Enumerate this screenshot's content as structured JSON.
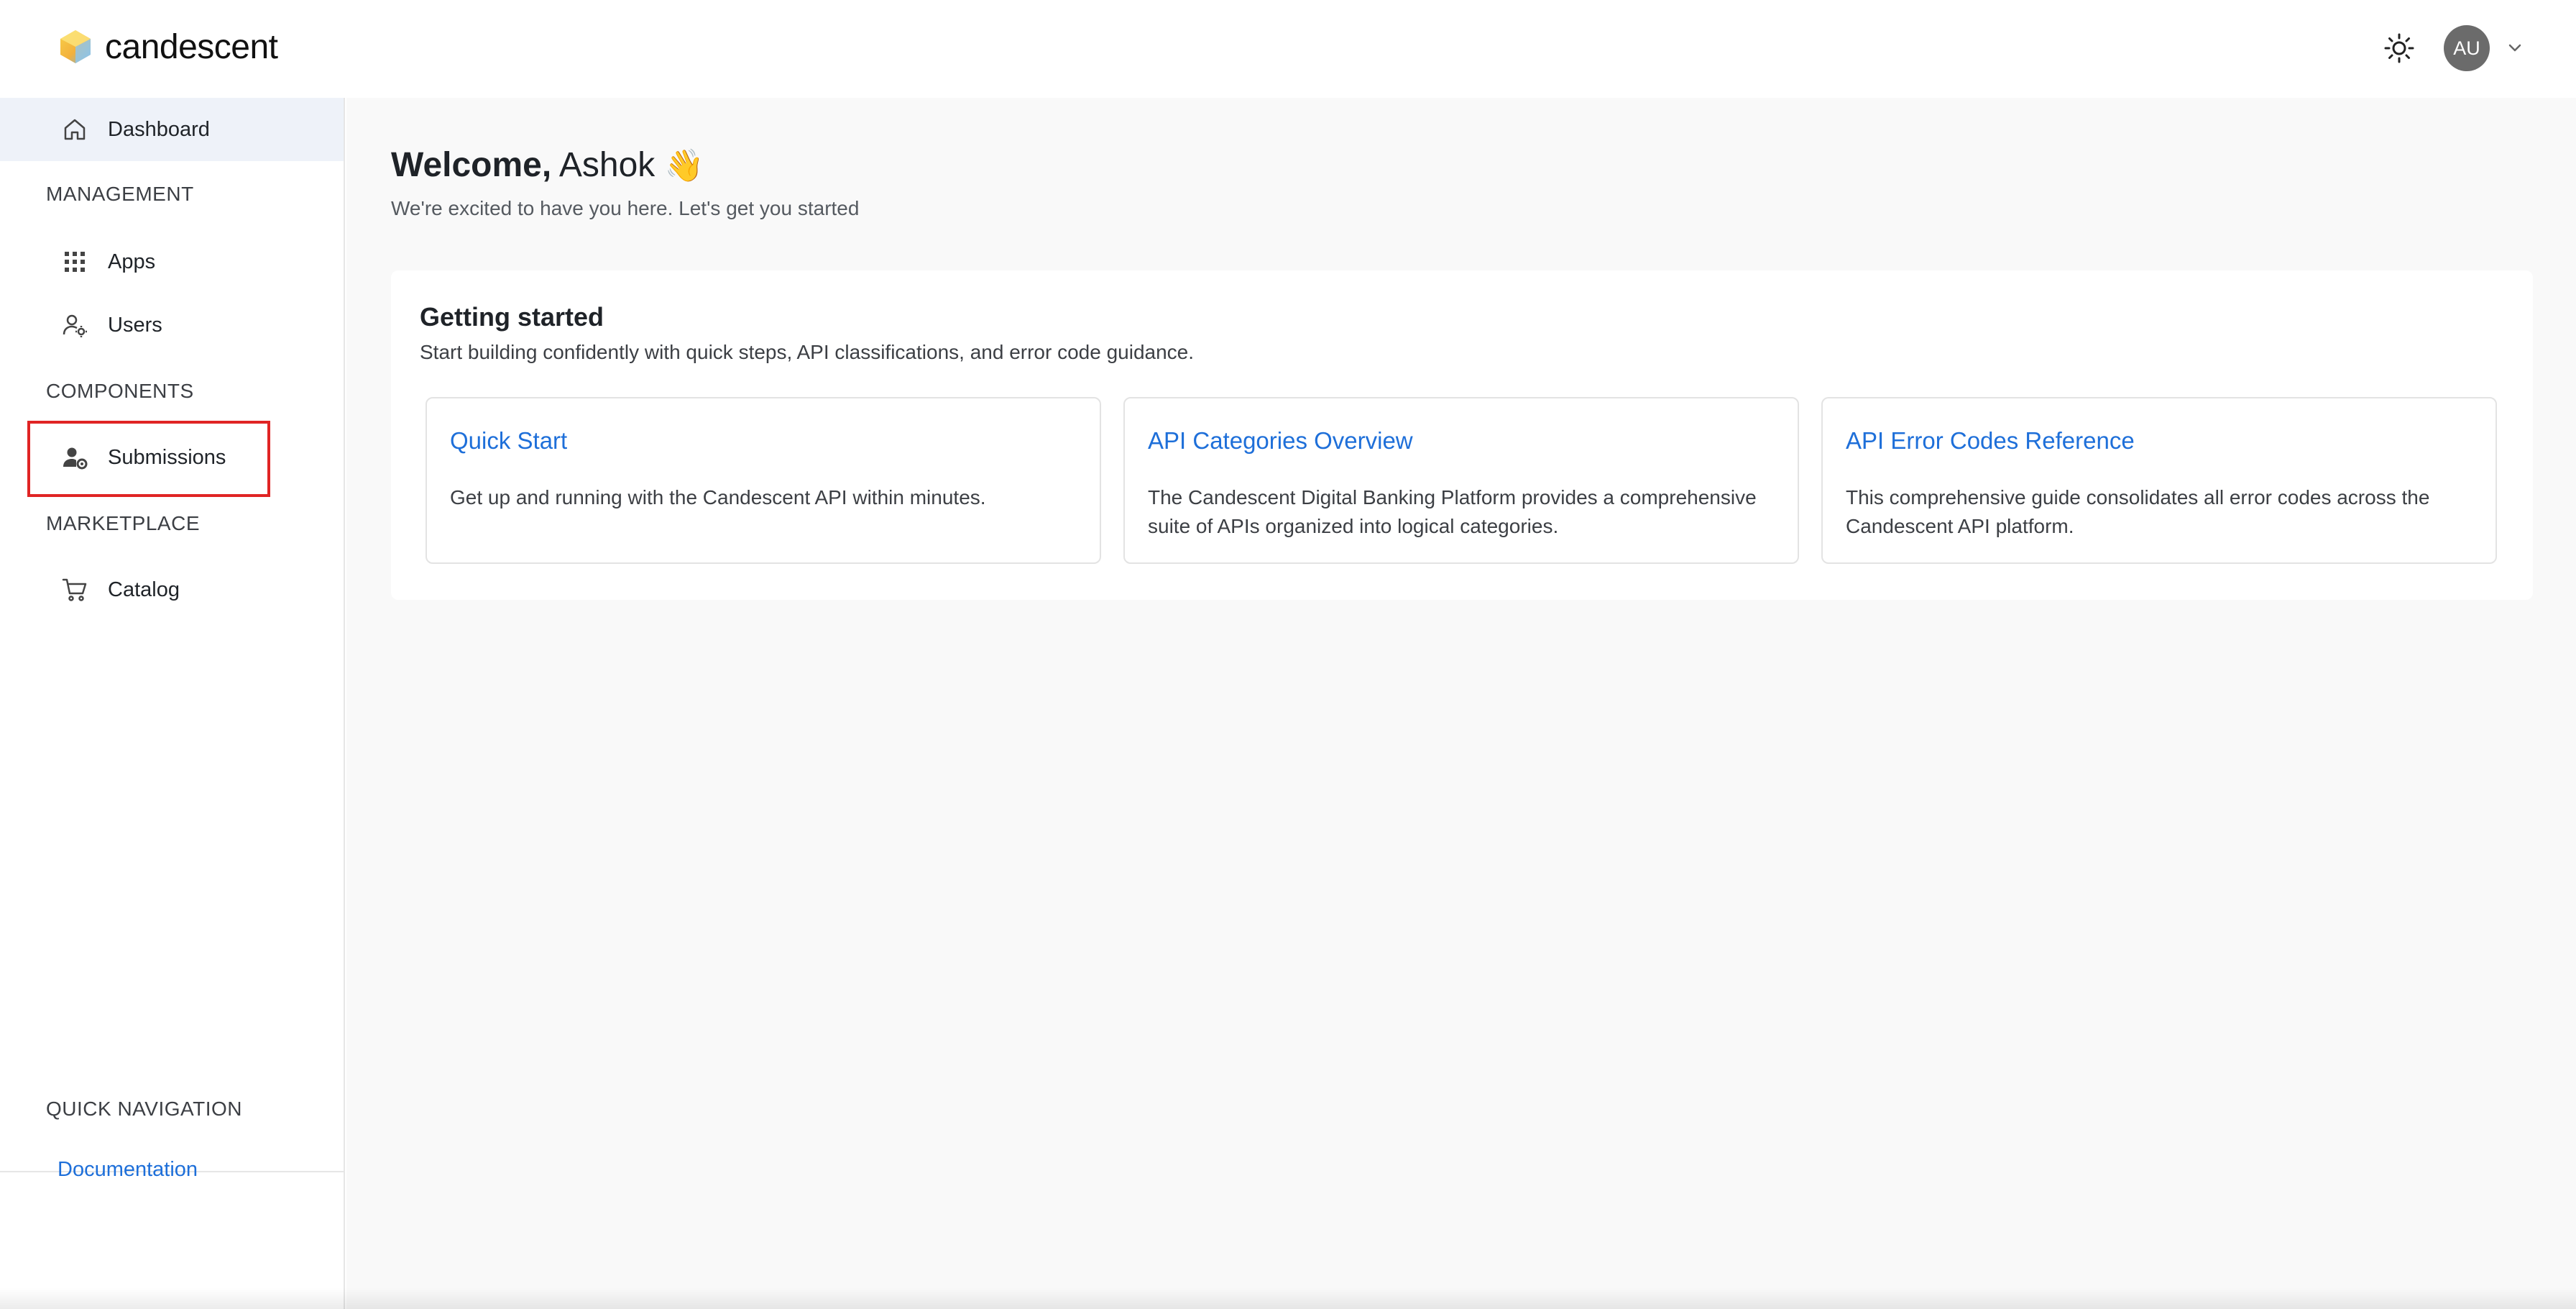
{
  "brand": {
    "name": "candescent",
    "logo_icon": "candescent-logo-icon"
  },
  "header": {
    "avatar_initials": "AU",
    "theme_icon": "sun-icon",
    "menu_icon": "chevron-down-icon"
  },
  "sidebar": {
    "dashboard": "Dashboard",
    "sections": {
      "management": "MANAGEMENT",
      "components": "COMPONENTS",
      "marketplace": "MARKETPLACE",
      "quick_navigation": "QUICK NAVIGATION"
    },
    "items": {
      "apps": "Apps",
      "users": "Users",
      "submissions": "Submissions",
      "catalog": "Catalog"
    },
    "documentation": "Documentation"
  },
  "main": {
    "welcome_bold": "Welcome,",
    "welcome_name": "Ashok",
    "welcome_emoji": "👋",
    "subtitle": "We're excited to have you here. Let's get you started",
    "getting_started": {
      "title": "Getting started",
      "description": "Start building confidently with quick steps, API classifications, and error code guidance.",
      "cards": [
        {
          "title": "Quick Start",
          "text": "Get up and running with the Candescent API within minutes."
        },
        {
          "title": "API Categories Overview",
          "text": "The Candescent Digital Banking Platform provides a comprehensive suite of APIs organized into logical categories."
        },
        {
          "title": "API Error Codes Reference",
          "text": "This comprehensive guide consolidates all error codes across the Candescent API platform."
        }
      ]
    }
  },
  "colors": {
    "accent": "#1e6fd9",
    "highlight": "#e02424",
    "active_bg": "#eef2f9",
    "avatar_bg": "#6b6b6b"
  }
}
